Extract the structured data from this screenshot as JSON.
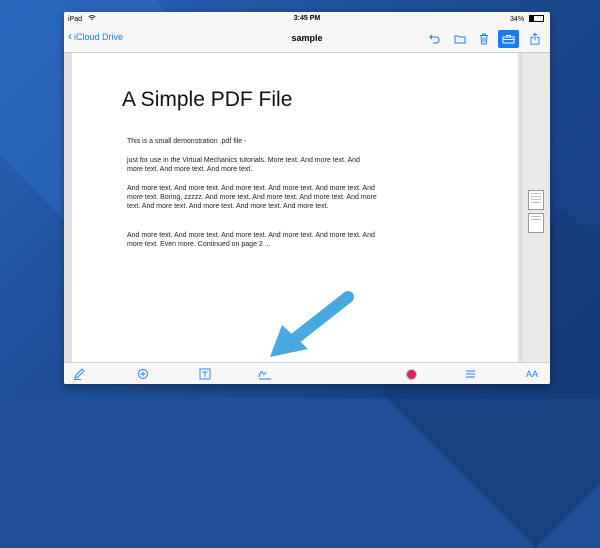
{
  "status_bar": {
    "device": "iPad",
    "time": "3:45 PM",
    "battery": "34%"
  },
  "nav_bar": {
    "back_label": "iCloud Drive",
    "title": "sample",
    "icons": [
      "undo-icon",
      "folder-icon",
      "trash-icon",
      "toolbox-icon",
      "share-icon"
    ]
  },
  "document": {
    "title": "A Simple PDF File",
    "paragraphs": [
      "This is a small demonstration .pdf file -",
      "just for use in the Virtual Mechanics tutorials. More text. And more text. And more text. And more text. And more text.",
      "And more text. And more text. And more text. And more text. And more text. And more text. Boring, zzzzz. And more text. And more text. And more text. And more text. And more text. And more text. And more text. And more text.",
      "And more text. And more text. And more text. And more text. And more text. And more text. Even more. Continued on page 2 ..."
    ]
  },
  "toolbar": {
    "icons": [
      "pen-icon",
      "stamp-icon",
      "text-box-icon",
      "signature-icon",
      "color-picker",
      "menu-icon",
      "font-size-icon"
    ],
    "font_size_label": "AA",
    "color": "#e21d63"
  },
  "colors": {
    "accent": "#1a7cf5",
    "background": "#1f4f96",
    "arrow": "#4aa8e0"
  }
}
